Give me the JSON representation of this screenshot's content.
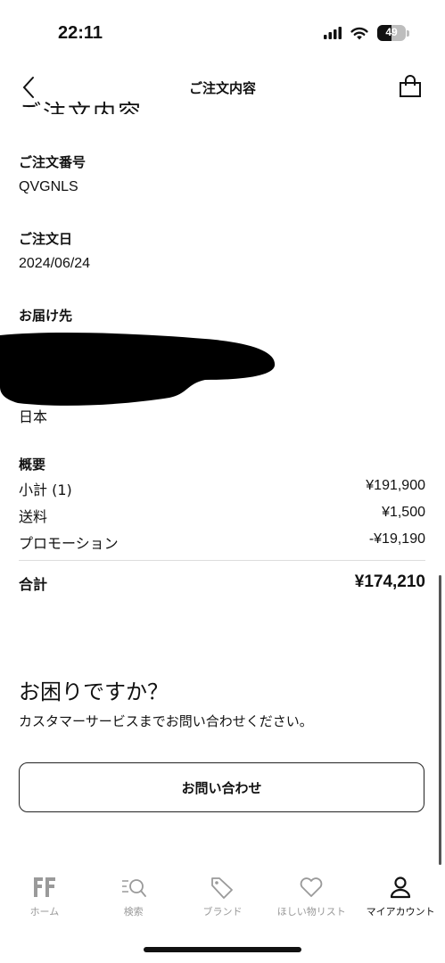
{
  "status_bar": {
    "time": "22:11",
    "battery": 49
  },
  "nav": {
    "title": "ご注文内容"
  },
  "heading_partial": "ご注文内容",
  "order": {
    "number_label": "ご注文番号",
    "number": "QVGNLS",
    "date_label": "ご注文日",
    "date": "2024/06/24",
    "address_label": "お届け先",
    "country": "日本"
  },
  "summary": {
    "label": "概要",
    "rows": [
      {
        "label": "小計 (1)",
        "amount": "¥191,900"
      },
      {
        "label": "送料",
        "amount": "¥1,500"
      },
      {
        "label": "プロモーション",
        "amount": "-¥19,190"
      }
    ],
    "total_label": "合計",
    "total": "¥174,210"
  },
  "help": {
    "title": "お困りですか？",
    "text": "カスタマーサービスまでお問い合わせください。",
    "button": "お問い合わせ"
  },
  "tabs": [
    {
      "label": "ホーム",
      "icon": "home-logo-icon"
    },
    {
      "label": "検索",
      "icon": "search-icon"
    },
    {
      "label": "ブランド",
      "icon": "tag-icon"
    },
    {
      "label": "ほしい物リスト",
      "icon": "heart-icon"
    },
    {
      "label": "マイアカウント",
      "icon": "account-icon",
      "active": true
    }
  ],
  "colors": {
    "text": "#111111",
    "muted": "#999999",
    "divider": "#dddddd"
  }
}
